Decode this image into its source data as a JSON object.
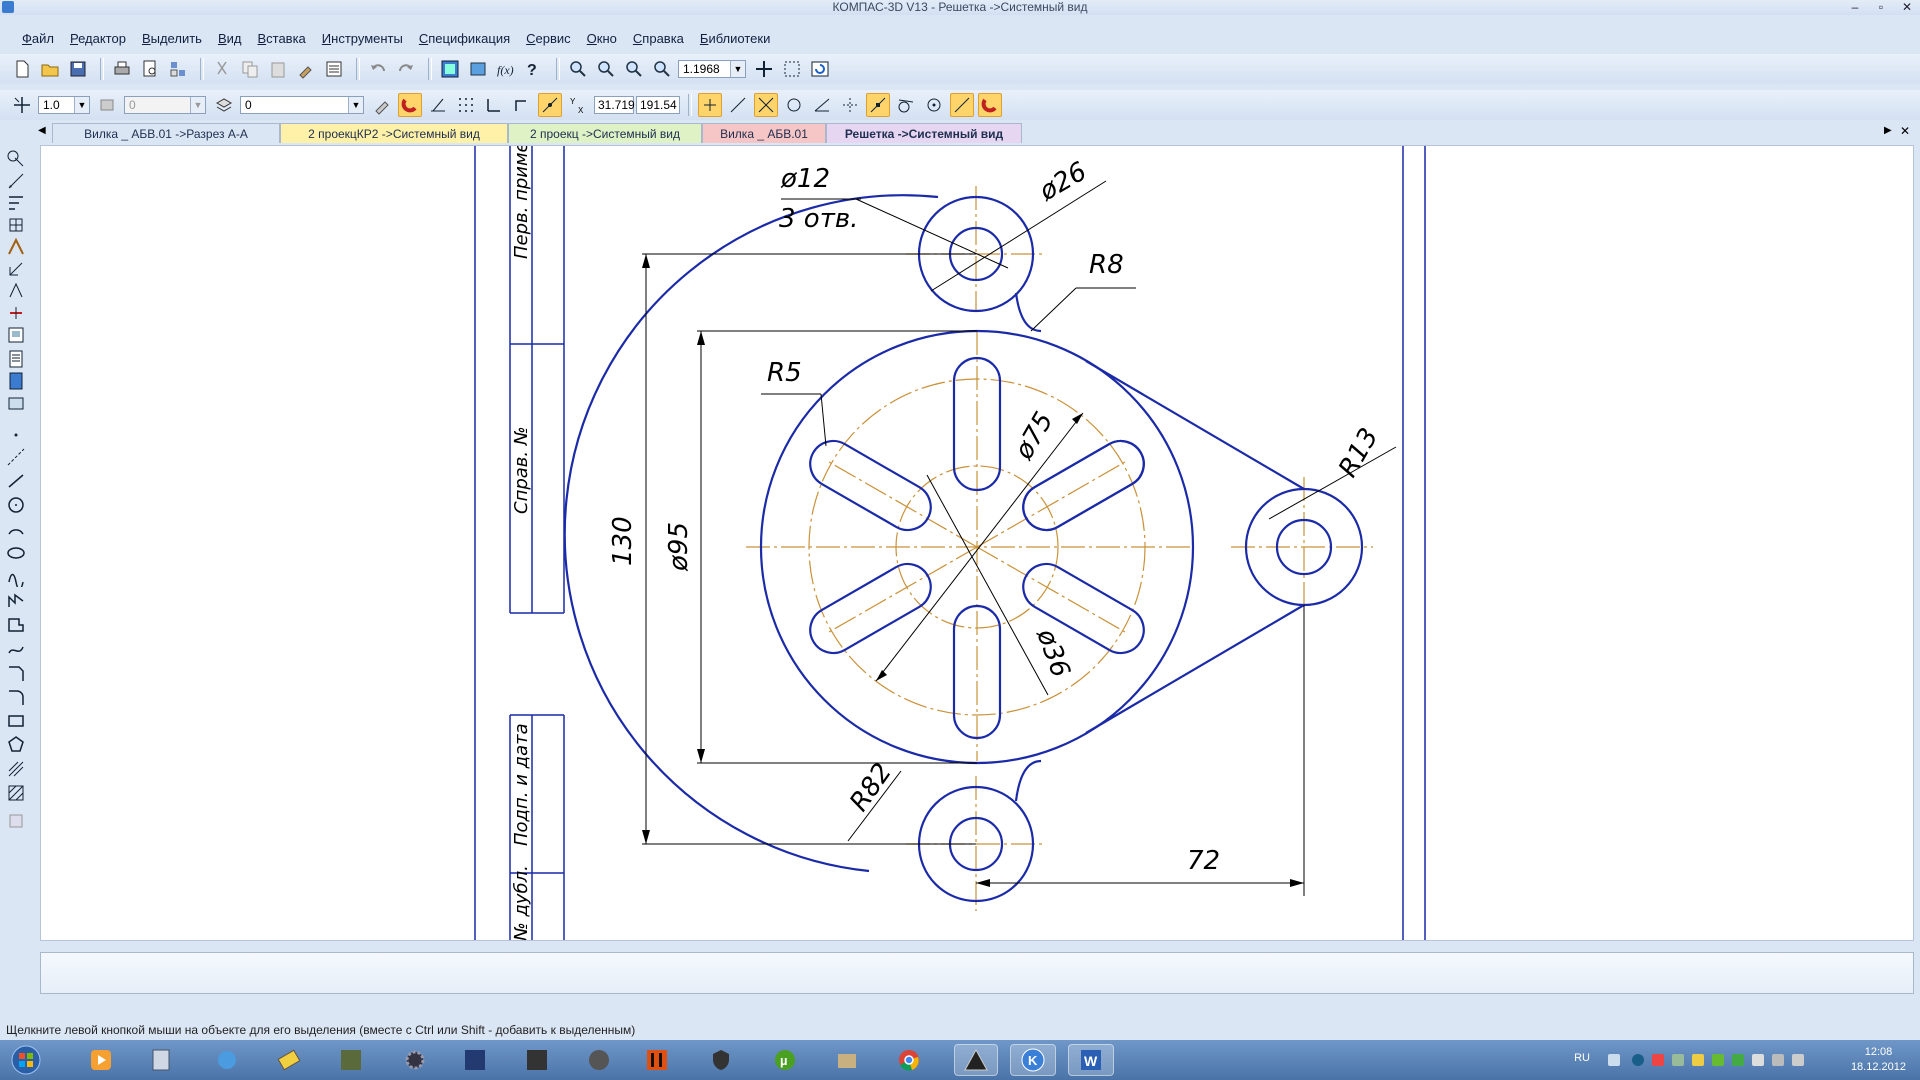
{
  "window": {
    "title": "КОМПАС-3D V13 - Решетка ->Системный вид",
    "controls": [
      "–",
      "▫",
      "✕"
    ]
  },
  "menu": [
    "Файл",
    "Редактор",
    "Выделить",
    "Вид",
    "Вставка",
    "Инструменты",
    "Спецификация",
    "Сервис",
    "Окно",
    "Справка",
    "Библиотеки"
  ],
  "toolbar1": {
    "zoom_value": "1.1968"
  },
  "toolbar2": {
    "step_value": "1.0",
    "layer_value": "0",
    "style_value": "0",
    "coord_x": "31.719",
    "coord_y": "191.54"
  },
  "tabs": [
    {
      "label": "Вилка _ АБВ.01 ->Разрез А-А",
      "color": "#dbe6f4"
    },
    {
      "label": "2 проекцКР2 ->Системный вид",
      "color": "#fff2a8"
    },
    {
      "label": "2 проекц ->Системный вид",
      "color": "#dff2c6"
    },
    {
      "label": "Вилка _ АБВ.01",
      "color": "#f6c6c6"
    },
    {
      "label": "Решетка ->Системный вид",
      "color": "#e6d6f2",
      "active": true
    }
  ],
  "frame_labels": {
    "perv_primen": "Перв. примен.",
    "sprav_no": "Справ. №",
    "podp_data": "Подп. и дата",
    "no_dubl": "№ дубл."
  },
  "dimensions": {
    "d12": "ø12",
    "holes": "3 отв.",
    "d26": "ø26",
    "r8": "R8",
    "r5": "R5",
    "d75": "ø75",
    "r13": "R13",
    "dim130": "130",
    "d95": "ø95",
    "d36": "ø36",
    "r82": "R82",
    "dim72": "72"
  },
  "colors": {
    "contour": "#1a2aa8",
    "axis": "#c9923a",
    "dimension": "#000000"
  },
  "status": {
    "hint": "Щелкните левой кнопкой мыши на объекте для его выделения (вместе с Ctrl или Shift - добавить к выделенным)"
  },
  "taskbar": {
    "lang": "RU",
    "time": "12:08",
    "date": "18.12.2012"
  }
}
